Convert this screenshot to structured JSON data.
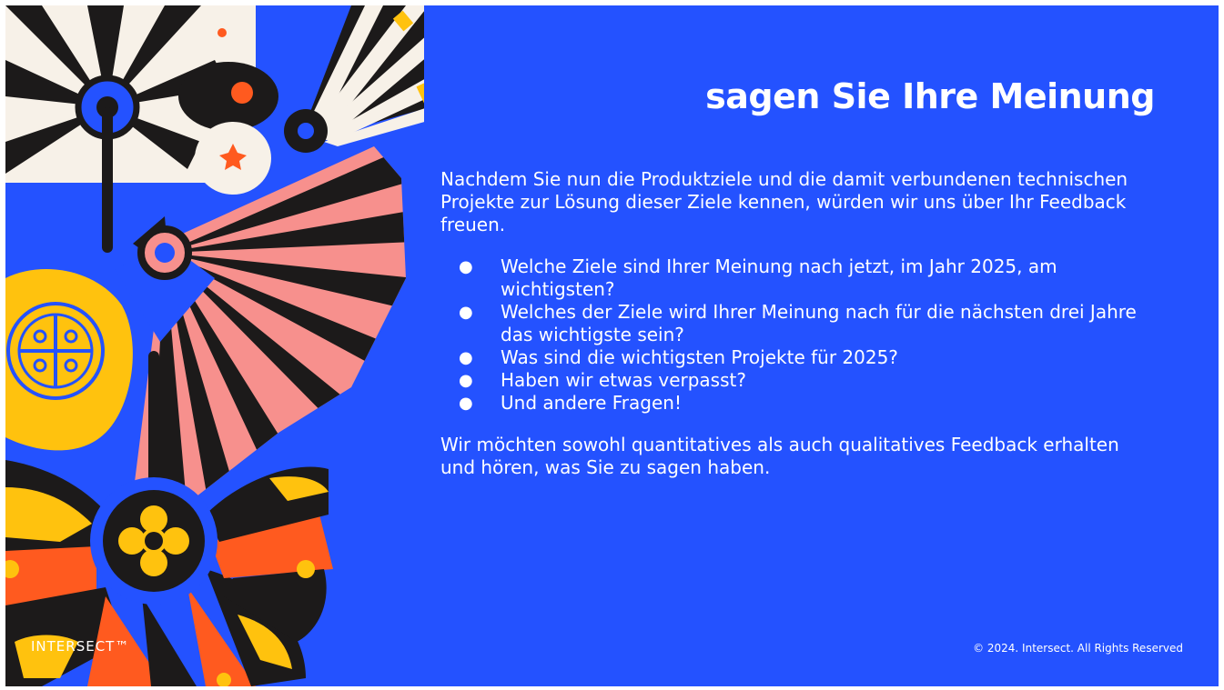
{
  "slide": {
    "title": "sagen Sie Ihre Meinung",
    "intro": "Nachdem Sie nun die Produktziele und die damit verbundenen technischen Projekte zur Lösung dieser Ziele kennen, würden wir uns über Ihr Feedback freuen.",
    "bullets": [
      "Welche Ziele sind Ihrer Meinung nach jetzt, im Jahr 2025, am wichtigsten?",
      "Welches der Ziele wird Ihrer Meinung nach für die nächsten drei Jahre das wichtigste sein?",
      "Was sind die wichtigsten Projekte für 2025?",
      "Haben wir etwas verpasst?",
      "Und andere Fragen!"
    ],
    "bullet_glyph": "●",
    "outro": "Wir möchten sowohl quantitatives als auch qualitatives Feedback erhalten und hören, was Sie zu sagen haben.",
    "logo": "INTERSECT™",
    "copyright": "© 2024. Intersect. All Rights Reserved"
  },
  "colors": {
    "background": "#2452ff",
    "text": "#ffffff",
    "black": "#1c1a1a",
    "cream": "#f7f1e8",
    "pink": "#f7908d",
    "yellow": "#ffc20e",
    "orange": "#ff5a1f"
  },
  "icons": [
    "paper-fan-icon",
    "medallion-icon",
    "flower-icon"
  ]
}
